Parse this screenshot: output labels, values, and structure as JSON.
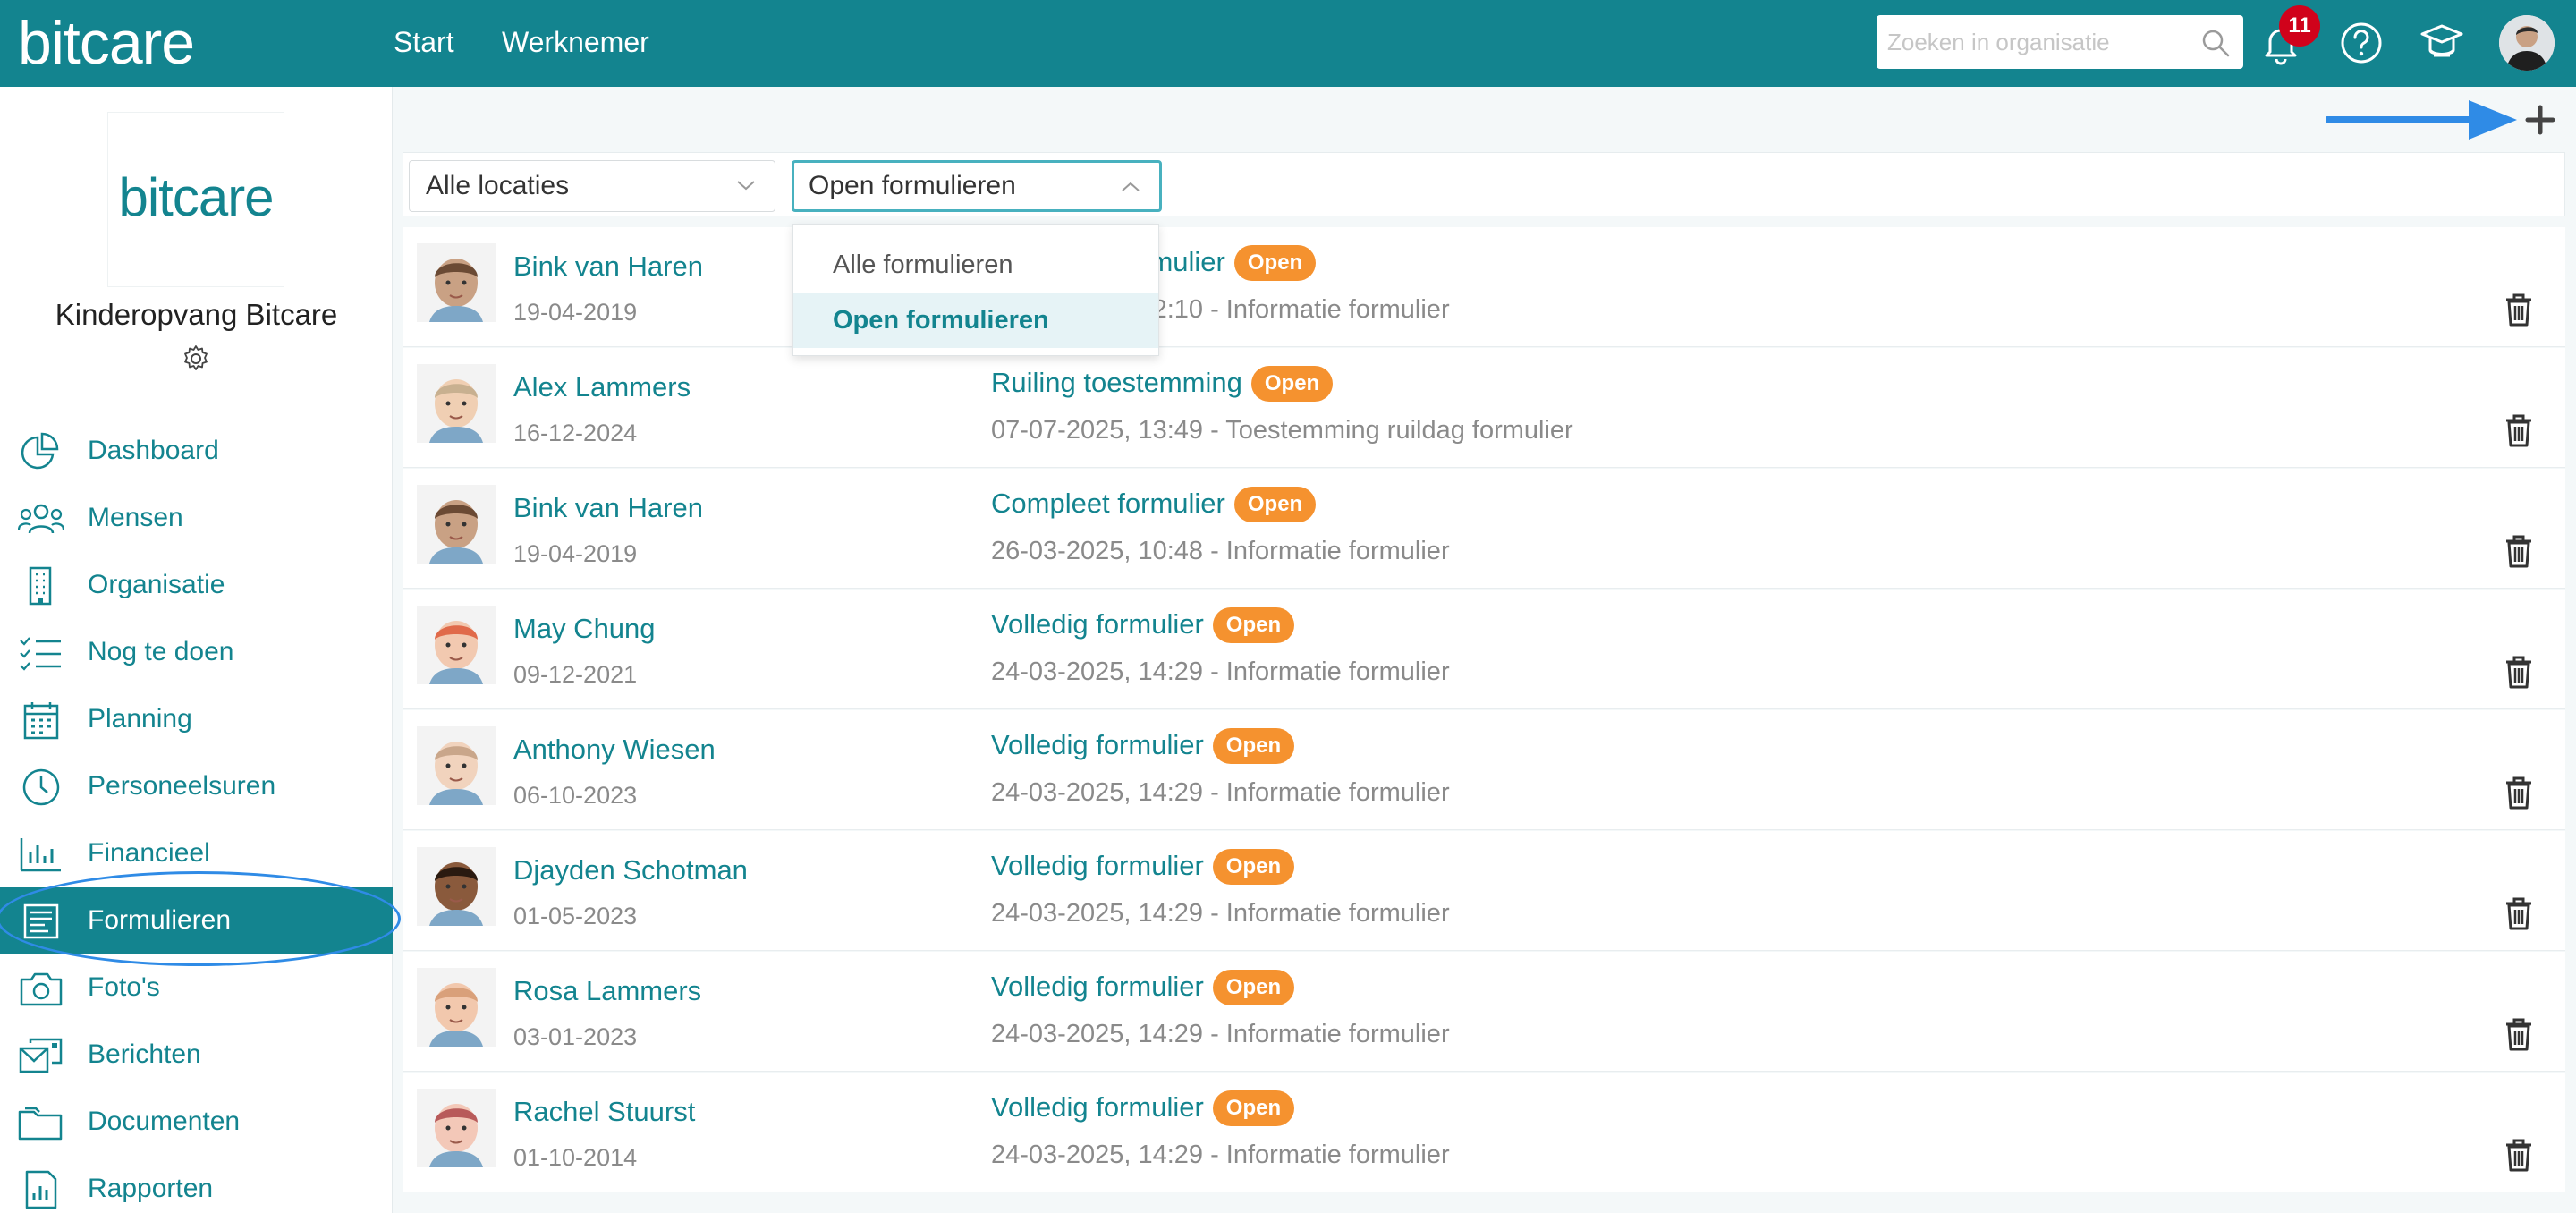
{
  "header": {
    "brand": "bitcare",
    "nav": [
      "Start",
      "Werknemer"
    ],
    "search_placeholder": "Zoeken in organisatie",
    "notification_count": "11",
    "colors": {
      "primary": "#13848f",
      "badge": "#d0021b"
    }
  },
  "sidebar": {
    "org_logo_text": "bitcare",
    "org_name": "Kinderopvang Bitcare",
    "items": [
      {
        "label": "Dashboard",
        "icon": "pie-chart-icon"
      },
      {
        "label": "Mensen",
        "icon": "people-icon"
      },
      {
        "label": "Organisatie",
        "icon": "building-icon"
      },
      {
        "label": "Nog te doen",
        "icon": "checklist-icon"
      },
      {
        "label": "Planning",
        "icon": "calendar-icon"
      },
      {
        "label": "Personeelsuren",
        "icon": "clock-icon"
      },
      {
        "label": "Financieel",
        "icon": "bar-chart-icon"
      },
      {
        "label": "Formulieren",
        "icon": "form-icon",
        "active": true
      },
      {
        "label": "Foto's",
        "icon": "camera-icon"
      },
      {
        "label": "Berichten",
        "icon": "messages-icon"
      },
      {
        "label": "Documenten",
        "icon": "folder-icon"
      },
      {
        "label": "Rapporten",
        "icon": "report-icon"
      }
    ]
  },
  "filters": {
    "location": "Alle locaties",
    "form_filter": "Open formulieren",
    "dropdown_options": [
      "Alle formulieren",
      "Open formulieren"
    ],
    "dropdown_selected": "Open formulieren"
  },
  "forms": [
    {
      "name": "Bink van Haren",
      "dob": "19-04-2019",
      "title": "Compleet formulier",
      "status": "Open",
      "desc": "26-03-2025, 12:10 - Informatie formulier"
    },
    {
      "name": "Alex Lammers",
      "dob": "16-12-2024",
      "title": "Ruiling toestemming",
      "status": "Open",
      "desc": "07-07-2025, 13:49 - Toestemming ruildag formulier"
    },
    {
      "name": "Bink van Haren",
      "dob": "19-04-2019",
      "title": "Compleet formulier",
      "status": "Open",
      "desc": "26-03-2025, 10:48 - Informatie formulier"
    },
    {
      "name": "May Chung",
      "dob": "09-12-2021",
      "title": "Volledig formulier",
      "status": "Open",
      "desc": "24-03-2025, 14:29 - Informatie formulier"
    },
    {
      "name": "Anthony Wiesen",
      "dob": "06-10-2023",
      "title": "Volledig formulier",
      "status": "Open",
      "desc": "24-03-2025, 14:29 - Informatie formulier"
    },
    {
      "name": "Djayden Schotman",
      "dob": "01-05-2023",
      "title": "Volledig formulier",
      "status": "Open",
      "desc": "24-03-2025, 14:29 - Informatie formulier"
    },
    {
      "name": "Rosa Lammers",
      "dob": "03-01-2023",
      "title": "Volledig formulier",
      "status": "Open",
      "desc": "24-03-2025, 14:29 - Informatie formulier"
    },
    {
      "name": "Rachel Stuurst",
      "dob": "01-10-2014",
      "title": "Volledig formulier",
      "status": "Open",
      "desc": "24-03-2025, 14:29 - Informatie formulier"
    }
  ]
}
